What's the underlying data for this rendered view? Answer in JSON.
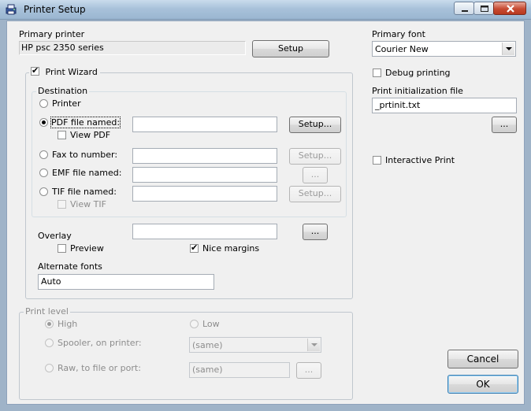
{
  "window": {
    "title": "Printer Setup"
  },
  "primary_printer": {
    "label": "Primary printer",
    "value": "HP psc 2350 series",
    "setup_button": "Setup"
  },
  "print_wizard": {
    "label": "Print Wizard",
    "checked": true
  },
  "destination": {
    "label": "Destination",
    "printer": "Printer",
    "pdf": {
      "label": "PDF file named:",
      "value": "",
      "setup": "Setup...",
      "view_pdf": "View PDF"
    },
    "fax": {
      "label": "Fax to number:",
      "value": "",
      "setup": "Setup..."
    },
    "emf": {
      "label": "EMF file named:",
      "value": "",
      "browse": "..."
    },
    "tif": {
      "label": "TIF file named:",
      "value": "",
      "setup": "Setup...",
      "view_tif": "View TIF"
    }
  },
  "overlay": {
    "label": "Overlay",
    "value": "",
    "browse": "...",
    "preview": "Preview",
    "nice_margins": "Nice margins"
  },
  "alternate_fonts": {
    "label": "Alternate fonts",
    "value": "Auto"
  },
  "print_level": {
    "label": "Print level",
    "high": "High",
    "low": "Low",
    "spooler": "Spooler, on printer:",
    "spooler_value": "(same)",
    "raw": "Raw, to file or port:",
    "raw_value": "(same)",
    "raw_browse": "..."
  },
  "primary_font": {
    "label": "Primary font",
    "value": "Courier New"
  },
  "debug_printing": {
    "label": "Debug printing",
    "checked": false
  },
  "init_file": {
    "label": "Print initialization file",
    "value": "_prtinit.txt",
    "browse": "..."
  },
  "interactive_print": {
    "label": "Interactive Print",
    "checked": false
  },
  "buttons": {
    "cancel": "Cancel",
    "ok": "OK"
  }
}
